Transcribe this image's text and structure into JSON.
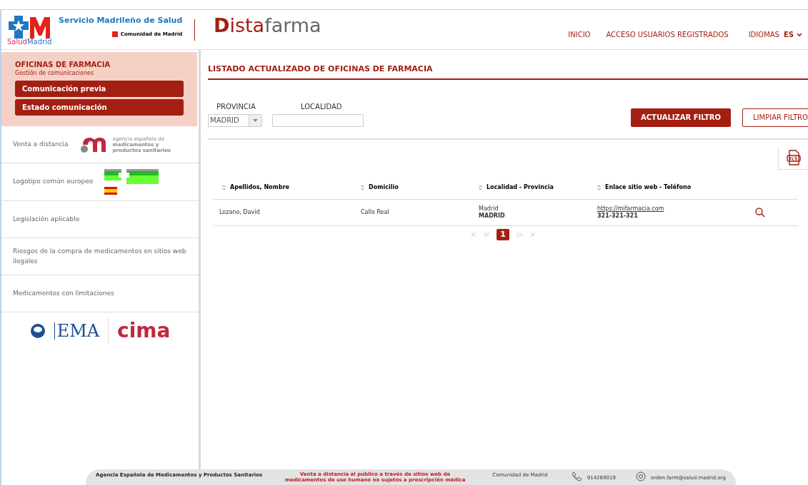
{
  "header": {
    "brand": {
      "title": "Servicio Madrileño de Salud",
      "sub_parts": [
        {
          "text": "Salud",
          "color": "#d6336c"
        },
        {
          "text": "Madrid",
          "color": "#1f78c1"
        }
      ],
      "region": "Comunidad de Madrid"
    },
    "app_logo": [
      {
        "text": "D",
        "color": "#a31f12"
      },
      {
        "text": "ista",
        "color": "#a31f12"
      },
      {
        "text": "farma",
        "color": "#666666"
      }
    ],
    "nav": [
      "INICIO",
      "ACCESO USUARIOS REGISTRADOS"
    ],
    "language": {
      "label": "IDIOMAS",
      "value": "ES"
    }
  },
  "sidebar": {
    "section": {
      "title": "OFICINAS DE FARMACIA",
      "subtitle": "Gestión de comunicaciones",
      "buttons": [
        "Comunicación previa",
        "Estado comunicación"
      ]
    },
    "items": [
      {
        "kind": "aemps",
        "label": "Venta a distancia",
        "logo_lines": [
          "agencia española de",
          "medicamentos y",
          "productos sanitarios"
        ]
      },
      {
        "kind": "eu_logo",
        "label": "Logotipo común europeo"
      },
      {
        "kind": "plain",
        "label": "Legislación aplicable"
      },
      {
        "kind": "plain",
        "label": "Riesgos de la compra de medicamentos en sitios web ilegales"
      },
      {
        "kind": "plain",
        "label": "Medicamentos con limitaciones"
      }
    ],
    "logos": [
      "EMA",
      "cima"
    ]
  },
  "main": {
    "title": "LISTADO ACTUALIZADO DE OFICINAS DE FARMACIA",
    "filters": {
      "provincia": {
        "label": "PROVINCIA",
        "value": "MADRID"
      },
      "localidad": {
        "label": "LOCALIDAD"
      }
    },
    "buttons": [
      {
        "label": "ACTUALIZAR FILTRO",
        "kind": "primary"
      },
      {
        "label": "LIMPIAR FILTRO",
        "kind": "outline"
      }
    ],
    "table": {
      "columns": [
        "Apellidos, Nombre",
        "Domicilio",
        "Localidad - Provincia",
        "Enlace sitio web - Teléfono"
      ],
      "rows": [
        {
          "name": "Lozano, David",
          "address": "Calle Real",
          "city": "Madrid",
          "province": "MADRID",
          "website": "https://mifarmacia.com",
          "phone": "321-321-321"
        }
      ]
    },
    "pagination": [
      {
        "label": "1",
        "selected": true
      }
    ]
  },
  "footer": [
    {
      "kind": "bold",
      "text": "Agencia Española de Medicamentos y Productos Sanitarios"
    },
    {
      "kind": "red",
      "text": "Venta a distancia al público a través de sitios web de medicamentos de uso humano no sujetos a prescripción médica"
    },
    {
      "kind": "plain",
      "text": "Comunidad de Madrid"
    },
    {
      "kind": "phone",
      "text": "914269019"
    },
    {
      "kind": "email",
      "text": "orden.farm@salud.madrid.org"
    }
  ]
}
